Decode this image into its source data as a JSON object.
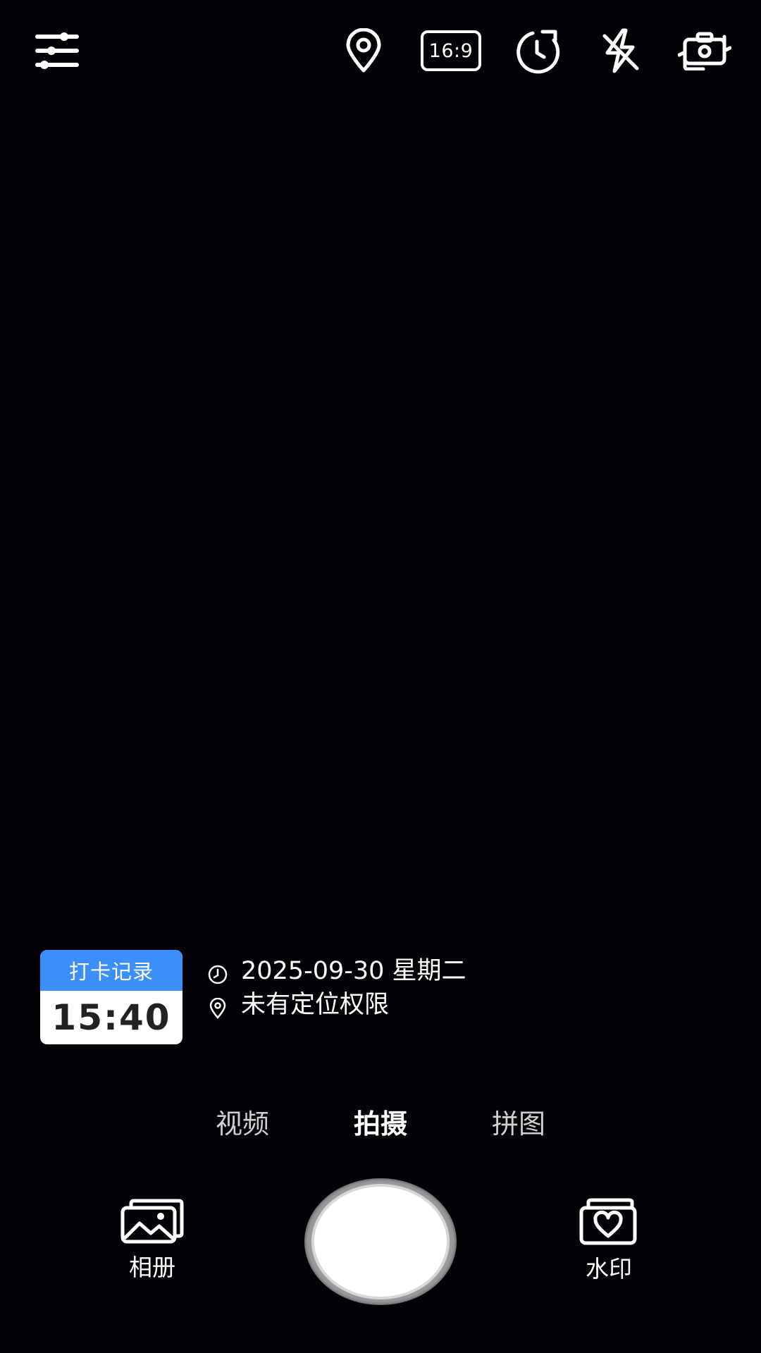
{
  "top_bar": {
    "settings_icon": "sliders-icon",
    "location_icon": "location-pin-icon",
    "aspect_ratio": "16:9",
    "timer_icon": "timer-icon",
    "flash_icon": "flash-off-icon",
    "switch_camera_icon": "switch-camera-icon"
  },
  "watermark_overlay": {
    "punch_card": {
      "title": "打卡记录",
      "time": "15:40",
      "accent_color": "#3a8ff8"
    },
    "date_line": "2025-09-30 星期二",
    "location_line": "未有定位权限"
  },
  "mode_tabs": {
    "items": [
      {
        "label": "视频",
        "active": false
      },
      {
        "label": "拍摄",
        "active": true
      },
      {
        "label": "拼图",
        "active": false
      }
    ]
  },
  "bottom_bar": {
    "album_label": "相册",
    "album_icon": "photo-album-icon",
    "watermark_label": "水印",
    "watermark_icon": "watermark-heart-icon"
  }
}
